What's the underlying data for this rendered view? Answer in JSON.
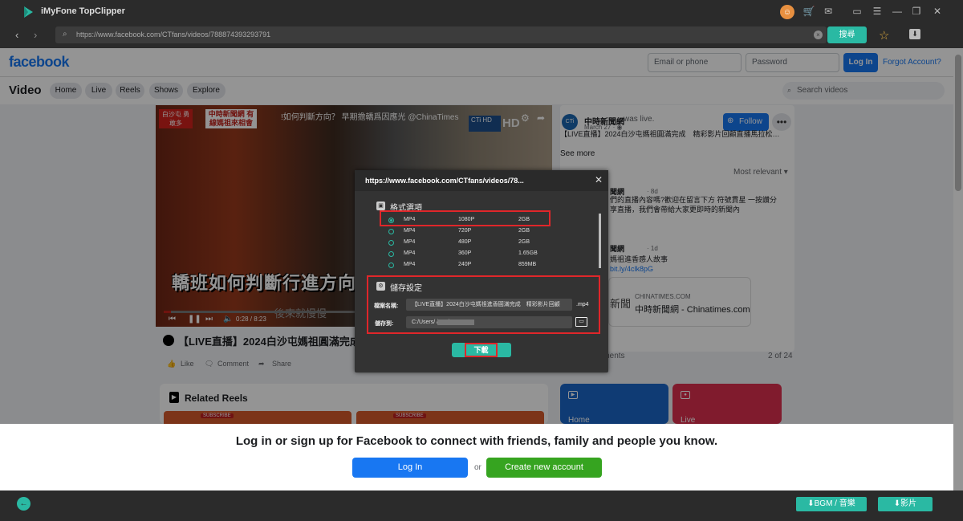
{
  "app": {
    "title": "iMyFone TopClipper",
    "avatar_glyph": "☺",
    "toolbar_icons": [
      "cart-icon",
      "mail-icon",
      "chat-icon",
      "menu-icon",
      "minimize-icon",
      "restore-icon",
      "close-icon"
    ],
    "accent_color": "#2ab9a3"
  },
  "browser": {
    "url": "https://www.facebook.com/CTfans/videos/788874393293791",
    "go_label": "搜尋",
    "clear_glyph": "×"
  },
  "facebook": {
    "logo": "facebook",
    "email_placeholder": "Email or phone",
    "password_placeholder": "Password",
    "login_label": "Log In",
    "forgot_label": "Forgot Account?",
    "section_title": "Video",
    "tabs": [
      "Home",
      "Live",
      "Reels",
      "Shows",
      "Explore"
    ],
    "search_placeholder": "Search videos",
    "video": {
      "caption": "轎班如何判斷行進方向",
      "sub_caption": "後來就慢慢",
      "top_text": "!如何判斷方向？ 早期擔轎爲因應光 @ChinaTimes",
      "station": "中時新聞網 有線媽祖來相會",
      "badge": "白沙屯 勇敢多",
      "hd_badge": "CTi HD",
      "hd_label": "HD",
      "time": "0:28 / 8:23",
      "progress": 0.02
    },
    "post_title": "【LIVE直播】2024白沙屯媽祖圓滿完成",
    "reactions": {
      "like": "Like",
      "comment": "Comment",
      "share": "Share"
    },
    "page": {
      "name": "中時新聞網",
      "was_live": "was live.",
      "date": "March 27 · ◉",
      "follow_label": "Follow",
      "more_glyph": "•••",
      "desc": "【LIVE直播】2024白沙屯媽祖圓滿完成　精彩影片回顧直播馬拉松…",
      "see_more": "See more",
      "most_relevant": "Most relevant ▾"
    },
    "comments": [
      {
        "author": "聞網",
        "time": "· 8d",
        "text": "們的直播內容嗎?歡迎在留言下方 符號貫星 一按讚分享直播，我們會帶給大家更即時的新聞內"
      },
      {
        "author": "聞網",
        "time": "· 1d",
        "text": "媽祖進香感人故事",
        "link": "bit.ly/4clk8pG"
      }
    ],
    "link_card": {
      "domain": "CHINATIMES.COM",
      "title": "中時新聞網 - Chinatimes.com",
      "thumb_text": "新聞"
    },
    "comments_label": "mments",
    "comments_count": "2 of 24",
    "related_reels": "Related Reels",
    "reel_badge": "SUBSCRIBE",
    "tiles": [
      {
        "label": "Home"
      },
      {
        "label": "Live"
      }
    ],
    "login_banner": {
      "text": "Log in or sign up for Facebook to connect with friends, family and people you know.",
      "login": "Log In",
      "or": "or",
      "create": "Create new account"
    }
  },
  "modal": {
    "url": "https://www.facebook.com/CTfans/videos/78...",
    "close_glyph": "✕",
    "format_section": "格式選項",
    "formats": [
      {
        "format": "MP4",
        "resolution": "1080P",
        "size": "2GB",
        "selected": true
      },
      {
        "format": "MP4",
        "resolution": "720P",
        "size": "2GB",
        "selected": false
      },
      {
        "format": "MP4",
        "resolution": "480P",
        "size": "2GB",
        "selected": false
      },
      {
        "format": "MP4",
        "resolution": "360P",
        "size": "1.65GB",
        "selected": false
      },
      {
        "format": "MP4",
        "resolution": "240P",
        "size": "859MB",
        "selected": false
      }
    ],
    "save_section": "儲存設定",
    "filename_label": "檔案名稱:",
    "filename_value": "【LIVE直播】2024白沙屯媽祖進香圓滿完成　精彩影片回顧",
    "filename_ext": ".mp4",
    "path_label": "儲存到:",
    "path_value": "C:/Users/              /Desktop",
    "download_label": "下載"
  },
  "bottom": {
    "bgm_label": "⬇BGM / 音樂",
    "video_label": "⬇影片",
    "back_glyph": "←"
  }
}
